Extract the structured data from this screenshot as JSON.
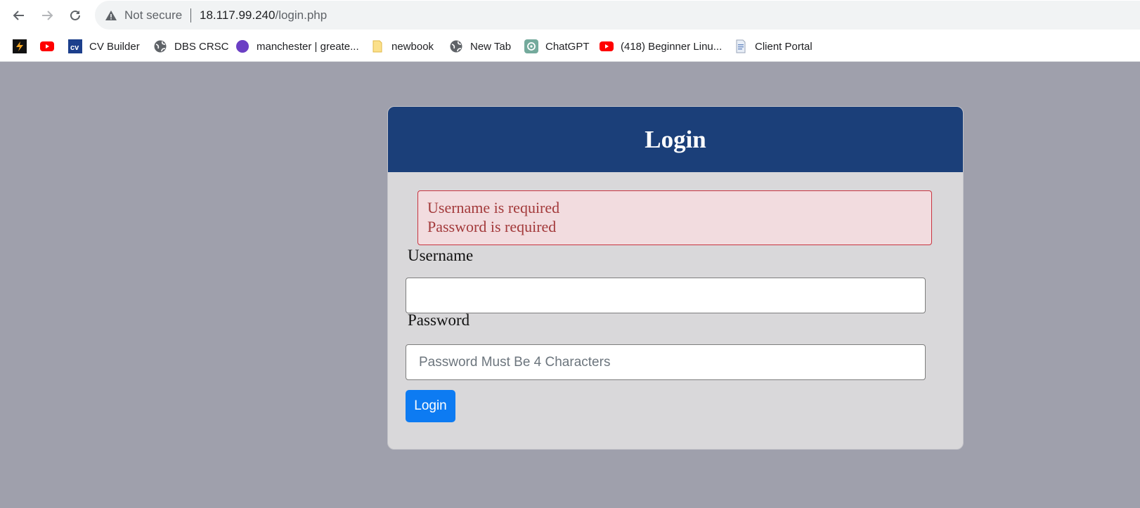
{
  "browser": {
    "security_label": "Not secure",
    "url_host": "18.117.99.240",
    "url_path": "/login.php",
    "nav": {
      "back_icon": "back-arrow-icon",
      "forward_icon": "forward-arrow-icon",
      "reload_icon": "reload-icon"
    }
  },
  "bookmarks": [
    {
      "label": "",
      "icon": "bolt-app-icon"
    },
    {
      "label": "",
      "icon": "youtube-icon"
    },
    {
      "label": "CV Builder",
      "icon": "cv-icon"
    },
    {
      "label": "DBS CRSC",
      "icon": "globe-icon"
    },
    {
      "label": "manchester | greate...",
      "icon": "purple-circle-icon"
    },
    {
      "label": "newbook",
      "icon": "folder-icon"
    },
    {
      "label": "New Tab",
      "icon": "globe-icon"
    },
    {
      "label": "ChatGPT",
      "icon": "chatgpt-icon"
    },
    {
      "label": "(418) Beginner Linu...",
      "icon": "youtube-icon"
    },
    {
      "label": "Client Portal",
      "icon": "document-icon"
    }
  ],
  "login": {
    "title": "Login",
    "errors": [
      "Username is required",
      "Password is required"
    ],
    "username_label": "Username",
    "username_value": "",
    "password_label": "Password",
    "password_placeholder": "Password Must Be 4 Characters",
    "submit_label": "Login"
  },
  "colors": {
    "page_bg": "#9fa0ac",
    "card_header": "#1b3f79",
    "card_body": "#d9d8da",
    "alert_bg": "#f2dcdf",
    "alert_text": "#a33a3b",
    "button": "#0d7bf2"
  }
}
